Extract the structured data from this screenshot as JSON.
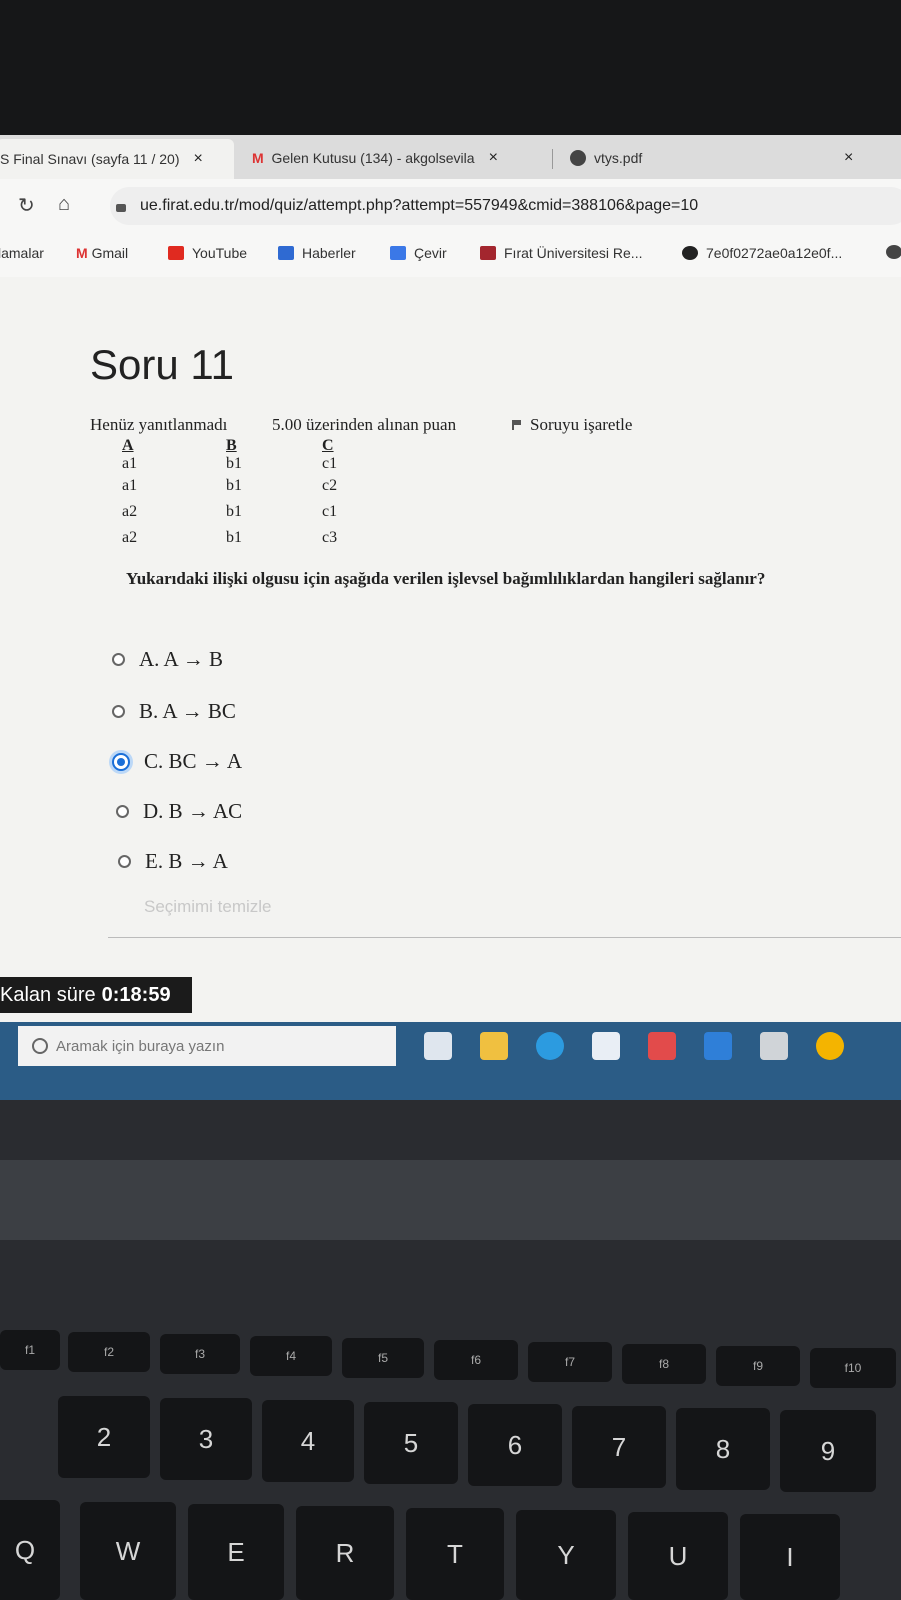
{
  "browser": {
    "tabs": [
      {
        "title": "S Final Sınavı (sayfa 11 / 20)",
        "close": "×"
      },
      {
        "title": "Gelen Kutusu (134) - akgolsevila",
        "close": "×"
      },
      {
        "title": "vtys.pdf",
        "close": "×"
      }
    ],
    "url": "ue.firat.edu.tr/mod/quiz/attempt.php?attempt=557949&cmid=388106&page=10",
    "bookmarks": [
      "lamalar",
      "Gmail",
      "YouTube",
      "Haberler",
      "Çevir",
      "Fırat Üniversitesi Re...",
      "7e0f0272ae0a12e0f..."
    ]
  },
  "quiz": {
    "title": "Soru 11",
    "status": "Henüz yanıtlanmadı",
    "points": "5.00 üzerinden alınan puan",
    "flag": "Soruyu işaretle",
    "relation": {
      "headers": [
        "A",
        "B",
        "C"
      ],
      "rows": [
        [
          "a1",
          "b1",
          "c1"
        ],
        [
          "a1",
          "b1",
          "c2"
        ],
        [
          "a2",
          "b1",
          "c1"
        ],
        [
          "a2",
          "b1",
          "c3"
        ]
      ]
    },
    "question": "Yukarıdaki ilişki olgusu için aşağıda verilen işlevsel bağımlılıklardan hangileri sağlanır?",
    "options": [
      {
        "label": "A. A → B",
        "selected": false
      },
      {
        "label": "B. A → BC",
        "selected": false
      },
      {
        "label": "C. BC → A",
        "selected": true
      },
      {
        "label": "D. B → AC",
        "selected": false
      },
      {
        "label": "E. B → A",
        "selected": false
      }
    ],
    "clear_choice": "Seçimimi temizle"
  },
  "timer": {
    "label": "Kalan süre",
    "value": "0:18:59"
  },
  "taskbar": {
    "search_placeholder": "Aramak için buraya yazın"
  },
  "keyboard": {
    "number_row": [
      "2",
      "3",
      "4",
      "5",
      "6",
      "7",
      "8",
      "9"
    ],
    "letter_row": [
      "Q",
      "W",
      "E",
      "R",
      "T",
      "Y",
      "U",
      "I"
    ],
    "fn_row": [
      "f1",
      "f2",
      "f3",
      "f4",
      "f5",
      "f6",
      "f7",
      "f8",
      "f9",
      "f10"
    ]
  }
}
